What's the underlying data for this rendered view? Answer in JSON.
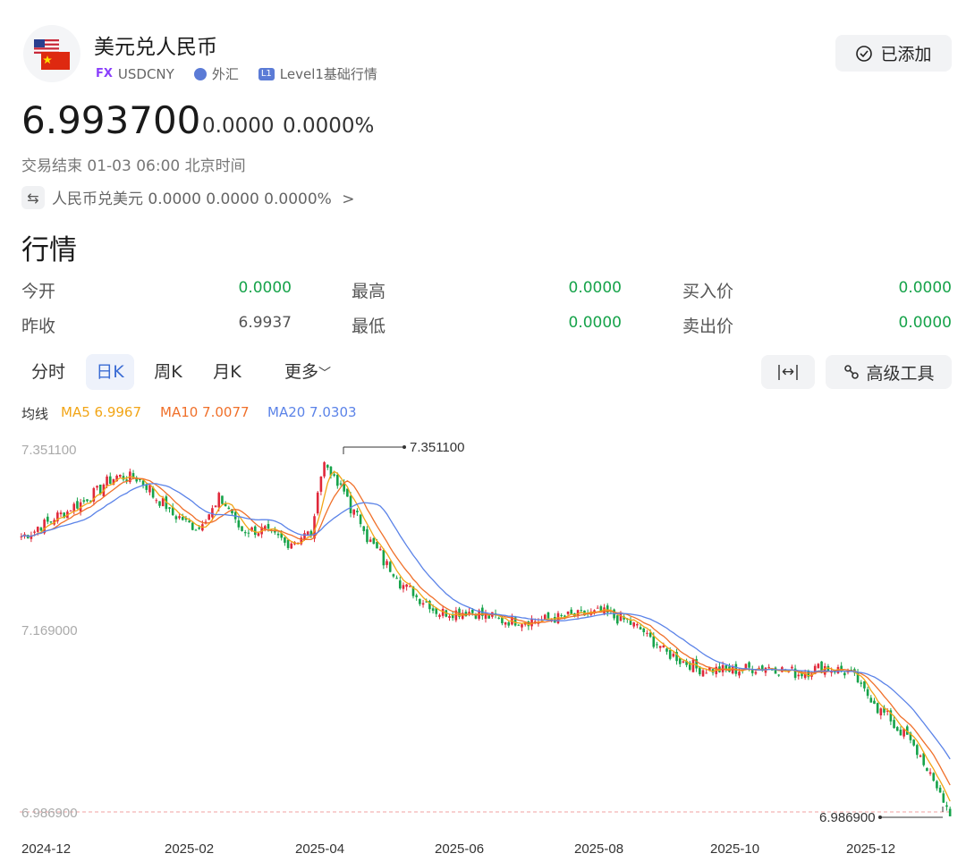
{
  "header": {
    "title": "美元兑人民币",
    "tag_fx": "FX",
    "symbol": "USDCNY",
    "market": "外汇",
    "level_badge": "L1",
    "level_text": "Level1基础行情",
    "added_label": "已添加"
  },
  "quote": {
    "price": "6.993700",
    "change": "0.0000",
    "change_pct": "0.0000%",
    "status": "交易结束 01-03 06:00 北京时间",
    "reverse_pair": "人民币兑美元 0.0000 0.0000 0.0000%",
    "reverse_chevron": ">"
  },
  "market": {
    "section_title": "行情",
    "rows": [
      [
        {
          "label": "今开",
          "value": "0.0000",
          "green": true
        },
        {
          "label": "最高",
          "value": "0.0000",
          "green": true
        },
        {
          "label": "买入价",
          "value": "0.0000",
          "green": true
        }
      ],
      [
        {
          "label": "昨收",
          "value": "6.9937",
          "green": false
        },
        {
          "label": "最低",
          "value": "0.0000",
          "green": true
        },
        {
          "label": "卖出价",
          "value": "0.0000",
          "green": true
        }
      ]
    ]
  },
  "chart_tabs": {
    "items": [
      "分时",
      "日K",
      "周K",
      "月K",
      "更多"
    ],
    "active_index": 1,
    "more_chevron": "﹀",
    "fit_label": "|↔|",
    "advanced_tools": "高级工具"
  },
  "indicators": {
    "label": "均线",
    "ma5": "MA5 6.9967",
    "ma10": "MA10 7.0077",
    "ma20": "MA20 7.0303",
    "ma5_color": "#f2a516",
    "ma10_color": "#f0702a",
    "ma20_color": "#5b83e8"
  },
  "colors": {
    "up": "#e0283a",
    "down": "#16a34a",
    "accent": "#3b6cd4"
  },
  "chart_data": {
    "type": "candlestick",
    "ylim": [
      6.9869,
      7.3511
    ],
    "y_ticks": [
      "7.351100",
      "7.169000",
      "6.986900"
    ],
    "x_ticks": [
      "2024-12",
      "2025-02",
      "2025-04",
      "2025-06",
      "2025-08",
      "2025-10",
      "2025-12"
    ],
    "high_annotation": "7.351100",
    "low_annotation": "6.986900",
    "approx_close_path": [
      [
        "2024-12-02",
        7.262
      ],
      [
        "2024-12-16",
        7.281
      ],
      [
        "2024-12-30",
        7.301
      ],
      [
        "2025-01-10",
        7.322
      ],
      [
        "2025-01-20",
        7.32
      ],
      [
        "2025-02-03",
        7.285
      ],
      [
        "2025-02-14",
        7.27
      ],
      [
        "2025-02-24",
        7.3
      ],
      [
        "2025-03-05",
        7.268
      ],
      [
        "2025-03-14",
        7.268
      ],
      [
        "2025-03-24",
        7.255
      ],
      [
        "2025-04-03",
        7.265
      ],
      [
        "2025-04-09",
        7.335
      ],
      [
        "2025-04-18",
        7.302
      ],
      [
        "2025-05-01",
        7.248
      ],
      [
        "2025-05-14",
        7.21
      ],
      [
        "2025-05-28",
        7.186
      ],
      [
        "2025-06-10",
        7.187
      ],
      [
        "2025-06-24",
        7.178
      ],
      [
        "2025-07-08",
        7.178
      ],
      [
        "2025-07-22",
        7.182
      ],
      [
        "2025-08-05",
        7.186
      ],
      [
        "2025-08-18",
        7.175
      ],
      [
        "2025-09-02",
        7.145
      ],
      [
        "2025-09-15",
        7.13
      ],
      [
        "2025-09-29",
        7.128
      ],
      [
        "2025-10-14",
        7.132
      ],
      [
        "2025-10-28",
        7.125
      ],
      [
        "2025-11-07",
        7.132
      ],
      [
        "2025-11-18",
        7.126
      ],
      [
        "2025-12-01",
        7.09
      ],
      [
        "2025-12-15",
        7.055
      ],
      [
        "2025-12-31",
        6.987
      ]
    ]
  }
}
